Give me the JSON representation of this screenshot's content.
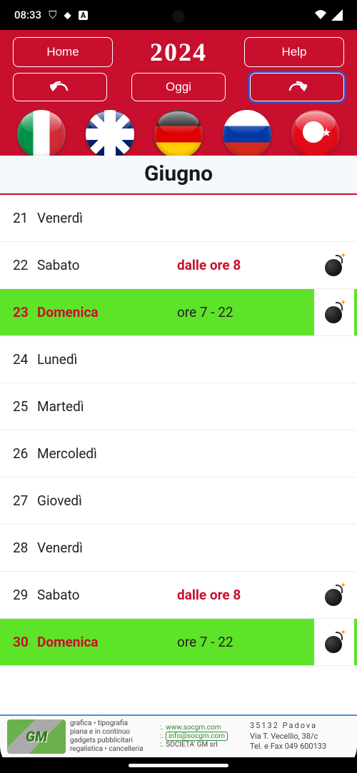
{
  "status": {
    "time": "08:33",
    "icons_left": [
      "⛉",
      "⬥",
      "A"
    ],
    "wifi": "▾",
    "signal": "◢"
  },
  "header": {
    "home_label": "Home",
    "help_label": "Help",
    "year": "2024",
    "back_label": "↶",
    "today_label": "Oggi",
    "forward_label": "↷"
  },
  "month_title": "Giugno",
  "flags": [
    {
      "name": "italy",
      "css": "flag-it"
    },
    {
      "name": "uk",
      "css": "flag-uk"
    },
    {
      "name": "germany",
      "css": "flag-de"
    },
    {
      "name": "russia",
      "css": "flag-ru"
    },
    {
      "name": "turkey",
      "css": "flag-tr"
    }
  ],
  "days": [
    {
      "num": "21",
      "dayname": "Venerdì",
      "note": "",
      "note_red": false,
      "green": false,
      "bomb": false
    },
    {
      "num": "22",
      "dayname": "Sabato",
      "note": "dalle ore 8",
      "note_red": true,
      "green": false,
      "bomb": true
    },
    {
      "num": "23",
      "dayname": "Domenica",
      "note": "ore 7 - 22",
      "note_red": false,
      "green": true,
      "bomb": true
    },
    {
      "num": "24",
      "dayname": "Lunedì",
      "note": "",
      "note_red": false,
      "green": false,
      "bomb": false
    },
    {
      "num": "25",
      "dayname": "Martedì",
      "note": "",
      "note_red": false,
      "green": false,
      "bomb": false
    },
    {
      "num": "26",
      "dayname": "Mercoledì",
      "note": "",
      "note_red": false,
      "green": false,
      "bomb": false
    },
    {
      "num": "27",
      "dayname": "Giovedì",
      "note": "",
      "note_red": false,
      "green": false,
      "bomb": false
    },
    {
      "num": "28",
      "dayname": "Venerdì",
      "note": "",
      "note_red": false,
      "green": false,
      "bomb": false
    },
    {
      "num": "29",
      "dayname": "Sabato",
      "note": "dalle ore 8",
      "note_red": true,
      "green": false,
      "bomb": true
    },
    {
      "num": "30",
      "dayname": "Domenica",
      "note": "ore 7 - 22",
      "note_red": false,
      "green": true,
      "bomb": true
    }
  ],
  "footer": {
    "logo_text": "GM",
    "tag1": "grafica • tipografia",
    "tag2": "piana e in continuo",
    "tag3": "gadgets pubblicitari",
    "tag4": "regalistica • cancelleria",
    "web": "www.socgm.com",
    "email": "info@socgm.com",
    "company": "SOCIETA' GM srl",
    "addr1": "35132 Padova",
    "addr2": "Via T. Vecellio, 38/c",
    "addr3": "Tel. e Fax 049 600133"
  }
}
